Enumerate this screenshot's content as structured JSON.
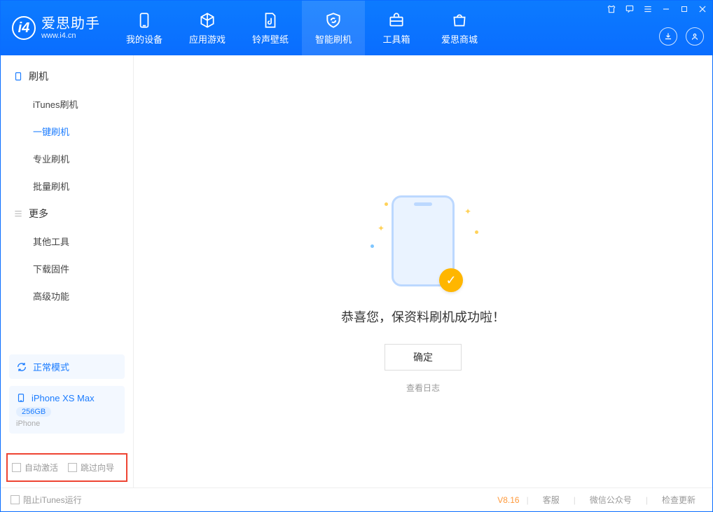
{
  "app": {
    "name_cn": "爱思助手",
    "url": "www.i4.cn"
  },
  "nav": {
    "items": [
      {
        "label": "我的设备"
      },
      {
        "label": "应用游戏"
      },
      {
        "label": "铃声壁纸"
      },
      {
        "label": "智能刷机"
      },
      {
        "label": "工具箱"
      },
      {
        "label": "爱思商城"
      }
    ]
  },
  "sidebar": {
    "groups": [
      {
        "title": "刷机",
        "items": [
          {
            "label": "iTunes刷机"
          },
          {
            "label": "一键刷机",
            "active": true
          },
          {
            "label": "专业刷机"
          },
          {
            "label": "批量刷机"
          }
        ]
      },
      {
        "title": "更多",
        "items": [
          {
            "label": "其他工具"
          },
          {
            "label": "下载固件"
          },
          {
            "label": "高级功能"
          }
        ]
      }
    ],
    "mode_card": {
      "label": "正常模式"
    },
    "device_card": {
      "name": "iPhone XS Max",
      "storage": "256GB",
      "type": "iPhone"
    },
    "options": {
      "auto_activate": "自动激活",
      "skip_guide": "跳过向导"
    }
  },
  "main": {
    "success_text": "恭喜您，保资料刷机成功啦！",
    "ok_button": "确定",
    "view_log": "查看日志"
  },
  "footer": {
    "block_itunes": "阻止iTunes运行",
    "version": "V8.16",
    "links": {
      "support": "客服",
      "wechat": "微信公众号",
      "check_update": "检查更新"
    }
  }
}
